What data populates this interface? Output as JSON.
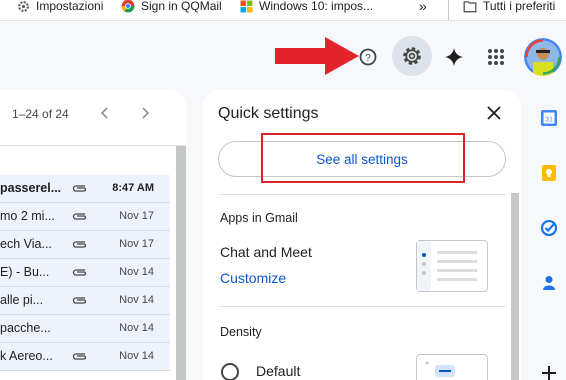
{
  "bookmarks": [
    {
      "label": "Impostazioni",
      "icon": "gear-icon"
    },
    {
      "label": "Sign in QQMail",
      "icon": "chrome-icon"
    },
    {
      "label": "Windows 10: impos...",
      "icon": "windows-icon"
    },
    {
      "label": "»",
      "icon": "more-bookmarks"
    },
    {
      "label": "Tutti i preferiti",
      "icon": "folder-icon"
    }
  ],
  "toolbar": {
    "icons": [
      "support-icon",
      "settings-gear-icon",
      "gemini-sparkle-icon",
      "apps-grid-icon",
      "avatar"
    ],
    "annotation_arrow_color": "#e3232b"
  },
  "mail_list": {
    "pager": "1–24 of 24",
    "rows": [
      {
        "subject": "passerel...",
        "attachment": true,
        "date": "8:47 AM",
        "bold": true
      },
      {
        "subject": "mo 2 mi...",
        "attachment": true,
        "date": "Nov 17",
        "bold": false
      },
      {
        "subject": "ech Via...",
        "attachment": true,
        "date": "Nov 17",
        "bold": false
      },
      {
        "subject": "E) - Bu...",
        "attachment": true,
        "date": "Nov 14",
        "bold": false
      },
      {
        "subject": "alle pi...",
        "attachment": true,
        "date": "Nov 14",
        "bold": false
      },
      {
        "subject": "pacche...",
        "attachment": false,
        "date": "Nov 14",
        "bold": false
      },
      {
        "subject": "k Aereo...",
        "attachment": true,
        "date": "Nov 14",
        "bold": false
      }
    ]
  },
  "quick_settings": {
    "title": "Quick settings",
    "see_all": "See all settings",
    "apps_section": "Apps in Gmail",
    "chat_meet": "Chat and Meet",
    "customize": "Customize",
    "density_section": "Density",
    "density_default": "Default",
    "highlight_color": "#d9252b"
  },
  "side_panel": {
    "icons": [
      "calendar-icon",
      "keep-icon",
      "tasks-icon",
      "contacts-icon",
      "add-icon"
    ],
    "calendar_day": "31"
  }
}
